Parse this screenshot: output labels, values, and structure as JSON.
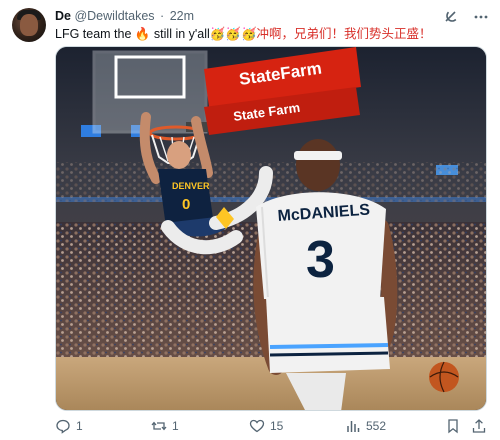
{
  "tweet": {
    "author": {
      "display_name": "De",
      "handle": "@Dewildtakes",
      "separator": "·",
      "time": "22m"
    },
    "text_en": "LFG team the 🔥 still in y'all",
    "emoji": "🥳🥳🥳",
    "text_cn": "冲啊，兄弟们！我们势头正盛！",
    "media": {
      "banner_top": "StateFarm",
      "banner_bottom": "State Farm",
      "jersey_name": "McDANIELS",
      "jersey_number": "3",
      "player_jersey_team": "DENVER",
      "player_jersey_number": "0"
    },
    "metrics": {
      "replies": "1",
      "reposts": "1",
      "likes": "15",
      "views": "552"
    }
  },
  "icons": {
    "grok": "grok-icon",
    "more": "more-icon",
    "reply": "reply-icon",
    "repost": "repost-icon",
    "like": "heart-icon",
    "views": "views-icon",
    "bookmark": "bookmark-icon",
    "share": "share-icon"
  },
  "colors": {
    "text_primary": "#0f1419",
    "text_secondary": "#536471",
    "chinese_text": "#d8302a",
    "statefarm_red": "#d62311",
    "wolves_white": "#f2f2f2",
    "wolves_navy": "#0c2340",
    "nuggets_navy": "#0e2240",
    "nuggets_gold": "#fec524"
  }
}
